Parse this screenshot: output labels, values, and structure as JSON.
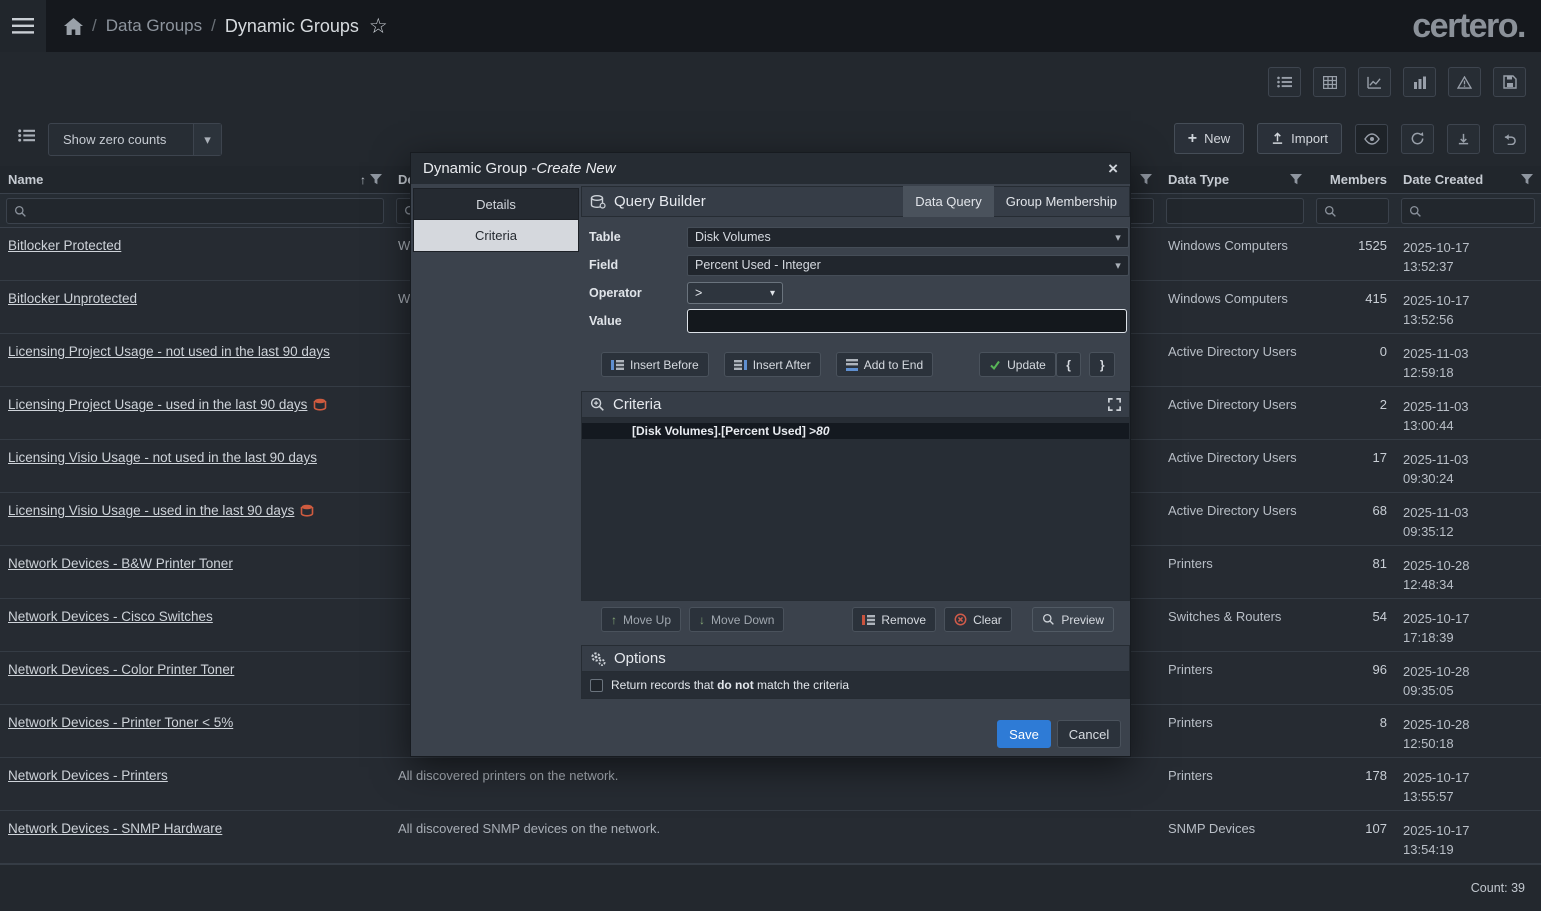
{
  "glyphs": {
    "sort_asc": "↑",
    "caret": "▾",
    "star": "☆",
    "plus": "+",
    "close": "×",
    "up_arrow": "↑",
    "down_arrow": "↓"
  },
  "topbar": {
    "sep1": "/",
    "crumb_parent": "Data Groups",
    "sep2": "/",
    "crumb_current": "Dynamic Groups",
    "logo": "certero."
  },
  "table_toolbar": {
    "zero_counts": "Show zero counts",
    "new": "New",
    "import": "Import"
  },
  "table": {
    "columns": [
      "Name",
      "Description",
      "Data Type",
      "Members",
      "Date Created"
    ],
    "rows": [
      {
        "name": "Bitlocker Protected",
        "desc": "W",
        "type": "Windows Computers",
        "members": "1525",
        "date": "2025-10-17",
        "time": "13:52:37",
        "flag": false
      },
      {
        "name": "Bitlocker Unprotected",
        "desc": "W",
        "type": "Windows Computers",
        "members": "415",
        "date": "2025-10-17",
        "time": "13:52:56",
        "flag": false
      },
      {
        "name": "Licensing Project Usage - not used in the last 90 days",
        "desc": "",
        "type": "Active Directory Users",
        "members": "0",
        "date": "2025-11-03",
        "time": "12:59:18",
        "flag": false
      },
      {
        "name": "Licensing Project Usage - used in the last 90 days",
        "desc": "",
        "type": "Active Directory Users",
        "members": "2",
        "date": "2025-11-03",
        "time": "13:00:44",
        "flag": true
      },
      {
        "name": "Licensing Visio Usage - not used in the last 90 days",
        "desc": "",
        "type": "Active Directory Users",
        "members": "17",
        "date": "2025-11-03",
        "time": "09:30:24",
        "flag": false
      },
      {
        "name": "Licensing Visio Usage - used in the last 90 days",
        "desc": "",
        "type": "Active Directory Users",
        "members": "68",
        "date": "2025-11-03",
        "time": "09:35:12",
        "flag": true
      },
      {
        "name": "Network Devices - B&W Printer Toner",
        "desc": "",
        "type": "Printers",
        "members": "81",
        "date": "2025-10-28",
        "time": "12:48:34",
        "flag": false
      },
      {
        "name": "Network Devices - Cisco Switches",
        "desc": "",
        "type": "Switches & Routers",
        "members": "54",
        "date": "2025-10-17",
        "time": "17:18:39",
        "flag": false
      },
      {
        "name": "Network Devices - Color Printer Toner",
        "desc": "",
        "type": "Printers",
        "members": "96",
        "date": "2025-10-28",
        "time": "09:35:05",
        "flag": false
      },
      {
        "name": "Network Devices - Printer Toner < 5%",
        "desc": "",
        "type": "Printers",
        "members": "8",
        "date": "2025-10-28",
        "time": "12:50:18",
        "flag": false
      },
      {
        "name": "Network Devices - Printers",
        "desc": "All discovered printers on the network.",
        "type": "Printers",
        "members": "178",
        "date": "2025-10-17",
        "time": "13:55:57",
        "flag": false
      },
      {
        "name": "Network Devices - SNMP Hardware",
        "desc": "All discovered SNMP devices on the network.",
        "type": "SNMP Devices",
        "members": "107",
        "date": "2025-10-17",
        "time": "13:54:19",
        "flag": false
      }
    ],
    "count": "Count: 39"
  },
  "modal": {
    "title_prefix": "Dynamic Group - ",
    "title_emphasis": "Create New",
    "side_tabs": [
      "Details",
      "Criteria"
    ],
    "qb": {
      "title": "Query Builder",
      "tabs": [
        "Data Query",
        "Group Membership"
      ],
      "table_label": "Table",
      "table_value": "Disk Volumes",
      "field_label": "Field",
      "field_value": "Percent Used - Integer",
      "operator_label": "Operator",
      "operator_value": ">",
      "value_label": "Value",
      "value_text": "",
      "insert_before": "Insert Before",
      "insert_after": "Insert After",
      "add_to_end": "Add to End",
      "update": "Update",
      "brace_open": "{",
      "brace_close": "}",
      "criteria_title": "Criteria",
      "expression_prefix": "[Disk Volumes].[Percent Used] > ",
      "expression_value": "80",
      "move_up": "Move Up",
      "move_down": "Move Down",
      "remove": "Remove",
      "clear": "Clear",
      "preview": "Preview",
      "options_title": "Options",
      "option_pre": "Return records that ",
      "option_bold": "do not",
      "option_post": " match the criteria",
      "save": "Save",
      "cancel": "Cancel"
    }
  }
}
